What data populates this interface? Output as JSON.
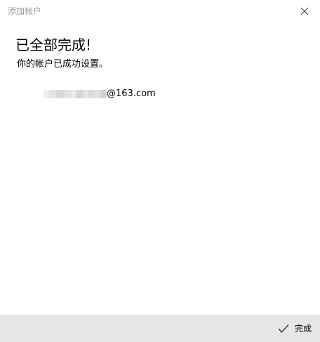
{
  "window": {
    "title": "添加帐户"
  },
  "main": {
    "heading": "已全部完成!",
    "subtext": "你的帐户已成功设置。",
    "account": {
      "email_domain": "@163.com"
    }
  },
  "footer": {
    "done_label": "完成"
  },
  "icons": {
    "close": "close-icon",
    "done": "checkmark-icon"
  }
}
